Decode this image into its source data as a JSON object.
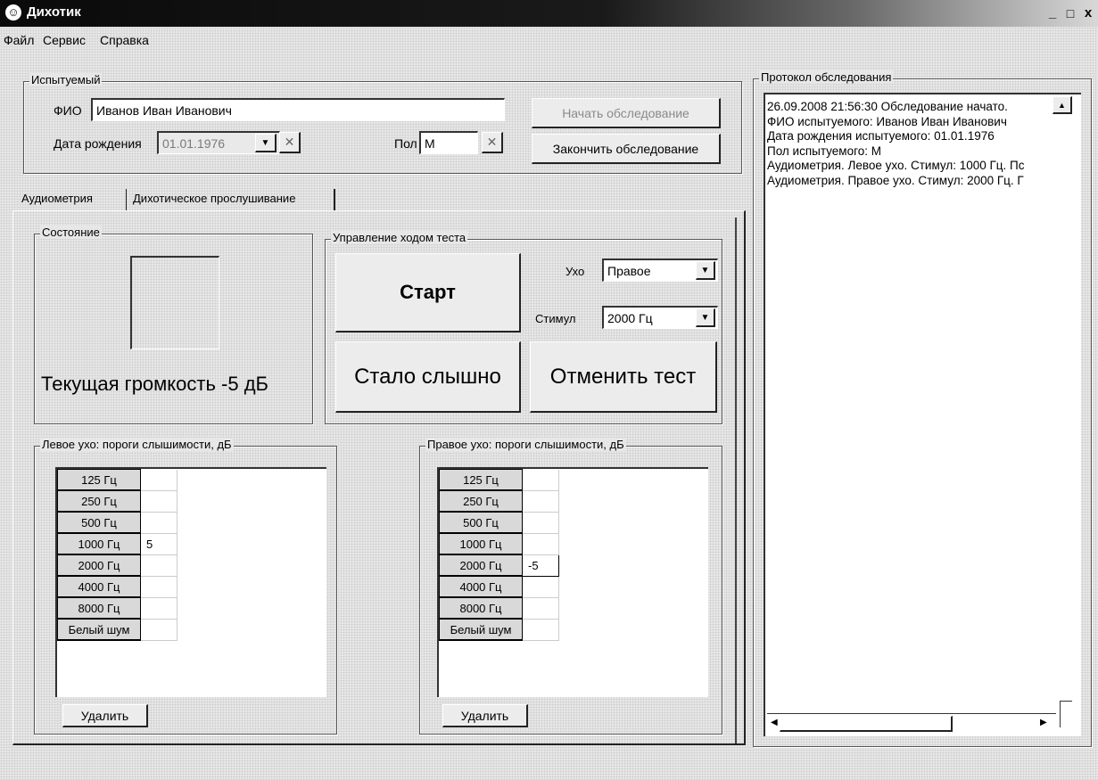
{
  "window": {
    "title": "Дихотик",
    "app_icon": "smiley-icon",
    "min": "_",
    "max": "□",
    "close": "x"
  },
  "menu": [
    {
      "label": "Файл"
    },
    {
      "label": "Сервис"
    },
    {
      "label": "Справка"
    }
  ],
  "subject": {
    "group_title": "Испытуемый",
    "fio_label": "ФИО",
    "fio_value": "Иванов Иван Иванович",
    "birth_label": "Дата рождения",
    "birth_value": "01.01.1976",
    "sex_label": "Пол",
    "sex_value": "М",
    "start_exam_button": "Начать обследование",
    "end_exam_button": "Закончить обследование"
  },
  "tabs": [
    {
      "label": "Аудиометрия",
      "active": true
    },
    {
      "label": "Дихотическое прослушивание",
      "active": false
    }
  ],
  "status": {
    "group_title": "Состояние",
    "current_volume": "Текущая громкость -5 дБ"
  },
  "control": {
    "group_title": "Управление ходом теста",
    "start_button": "Старт",
    "heard_button": "Стало слышно",
    "cancel_button": "Отменить тест",
    "ear_label": "Ухо",
    "ear_value": "Правое",
    "stimulus_label": "Стимул",
    "stimulus_value": "2000 Гц"
  },
  "left_ear": {
    "group_title": "Левое ухо: пороги слышимости, дБ",
    "rows": [
      {
        "freq": "125 Гц",
        "value": ""
      },
      {
        "freq": "250 Гц",
        "value": ""
      },
      {
        "freq": "500 Гц",
        "value": ""
      },
      {
        "freq": "1000 Гц",
        "value": "5"
      },
      {
        "freq": "2000 Гц",
        "value": ""
      },
      {
        "freq": "4000 Гц",
        "value": ""
      },
      {
        "freq": "8000 Гц",
        "value": ""
      },
      {
        "freq": "Белый шум",
        "value": ""
      }
    ],
    "delete_button": "Удалить"
  },
  "right_ear": {
    "group_title": "Правое ухо: пороги слышимости, дБ",
    "rows": [
      {
        "freq": "125 Гц",
        "value": ""
      },
      {
        "freq": "250 Гц",
        "value": ""
      },
      {
        "freq": "500 Гц",
        "value": ""
      },
      {
        "freq": "1000 Гц",
        "value": ""
      },
      {
        "freq": "2000 Гц",
        "value": "-5"
      },
      {
        "freq": "4000 Гц",
        "value": ""
      },
      {
        "freq": "8000 Гц",
        "value": ""
      },
      {
        "freq": "Белый шум",
        "value": ""
      }
    ],
    "delete_button": "Удалить"
  },
  "protocol": {
    "group_title": "Протокол обследования",
    "lines": [
      "26.09.2008 21:56:30 Обследование начато.",
      "ФИО испытуемого: Иванов Иван Иванович",
      "Дата рождения испытуемого: 01.01.1976",
      "Пол испытуемого: М",
      "Аудиометрия. Левое ухо. Стимул: 1000 Гц. Пс",
      "Аудиометрия. Правое ухо. Стимул: 2000 Гц. Г"
    ]
  },
  "icons": {
    "dropdown": "dropdown-arrow-icon",
    "clear": "clear-x-icon",
    "scroll_left": "scroll-left-icon",
    "scroll_right": "scroll-right-icon",
    "scroll_up": "scroll-up-icon"
  }
}
